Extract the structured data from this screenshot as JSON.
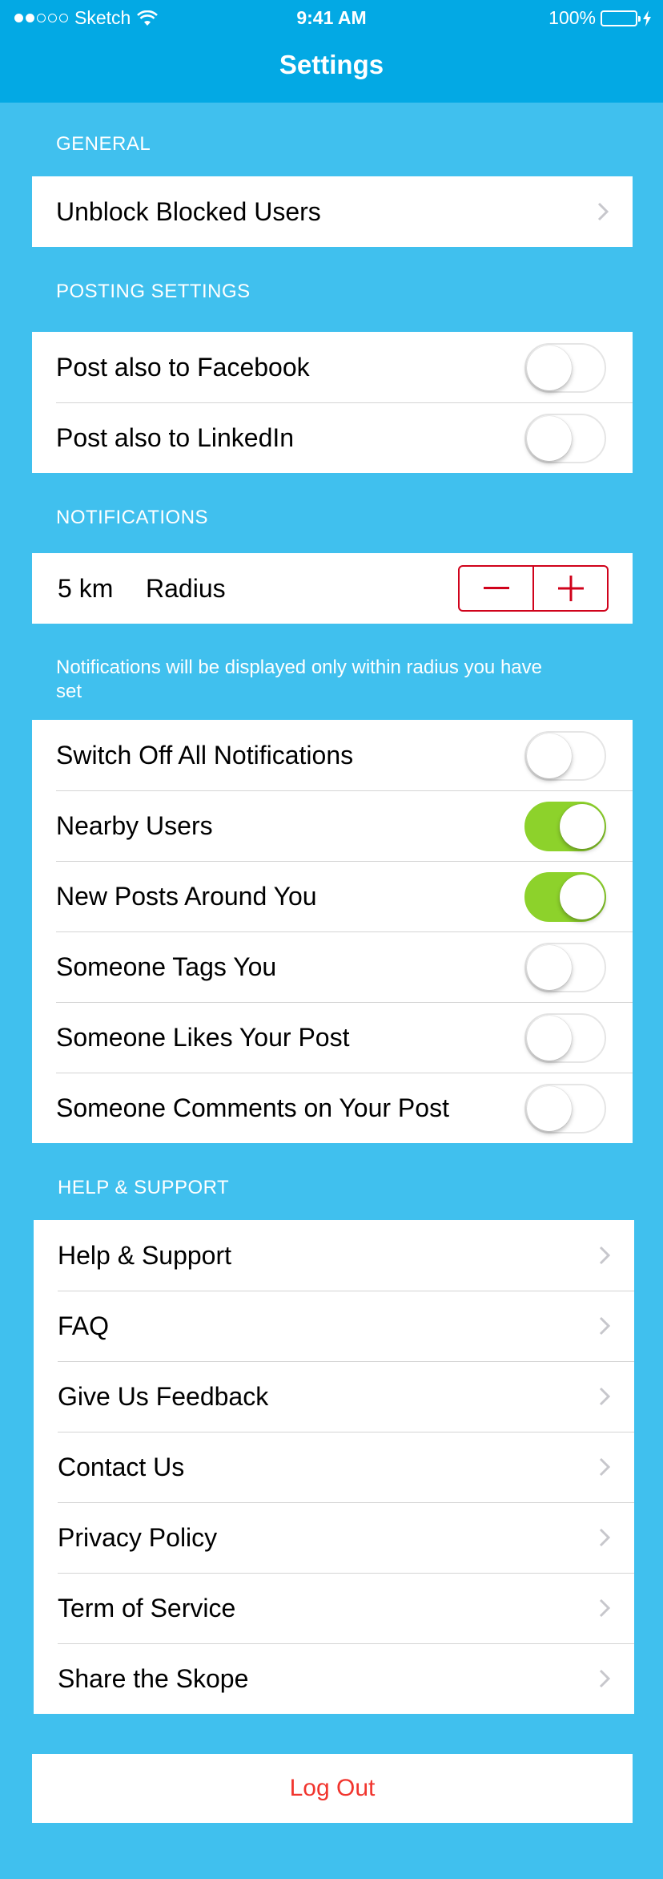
{
  "status_bar": {
    "carrier": "Sketch",
    "time": "9:41 AM",
    "battery": "100%"
  },
  "nav": {
    "title": "Settings"
  },
  "sections": {
    "general": {
      "header": "GENERAL",
      "items": [
        {
          "label": "Unblock Blocked Users"
        }
      ]
    },
    "posting": {
      "header": "POSTING SETTINGS",
      "items": [
        {
          "label": "Post also to Facebook",
          "on": false
        },
        {
          "label": "Post also to LinkedIn",
          "on": false
        }
      ]
    },
    "notifications": {
      "header": "NOTIFICATIONS",
      "radius_value": "5 km",
      "radius_label": "Radius",
      "note": "Notifications will be displayed only within radius you have set",
      "items": [
        {
          "label": "Switch Off All Notifications",
          "on": false
        },
        {
          "label": "Nearby Users",
          "on": true
        },
        {
          "label": "New Posts Around You",
          "on": true
        },
        {
          "label": "Someone Tags You",
          "on": false
        },
        {
          "label": "Someone Likes Your Post",
          "on": false
        },
        {
          "label": "Someone Comments on Your Post",
          "on": false
        }
      ]
    },
    "help": {
      "header": "HELP & SUPPORT",
      "items": [
        {
          "label": "Help & Support"
        },
        {
          "label": "FAQ"
        },
        {
          "label": "Give Us Feedback"
        },
        {
          "label": "Contact Us"
        },
        {
          "label": "Privacy Policy"
        },
        {
          "label": "Term of Service"
        },
        {
          "label": "Share the Skope"
        }
      ]
    }
  },
  "logout_label": "Log Out",
  "colors": {
    "background": "#40C0EE",
    "nav_bar": "#03A9E4",
    "toggle_on": "#8DD22B",
    "stepper": "#D0021B",
    "logout_text": "#F1352E"
  },
  "icons": {
    "chevron": "chevron-right-icon",
    "minus": "minus-icon",
    "plus": "plus-icon",
    "wifi": "wifi-icon",
    "battery": "battery-icon"
  }
}
